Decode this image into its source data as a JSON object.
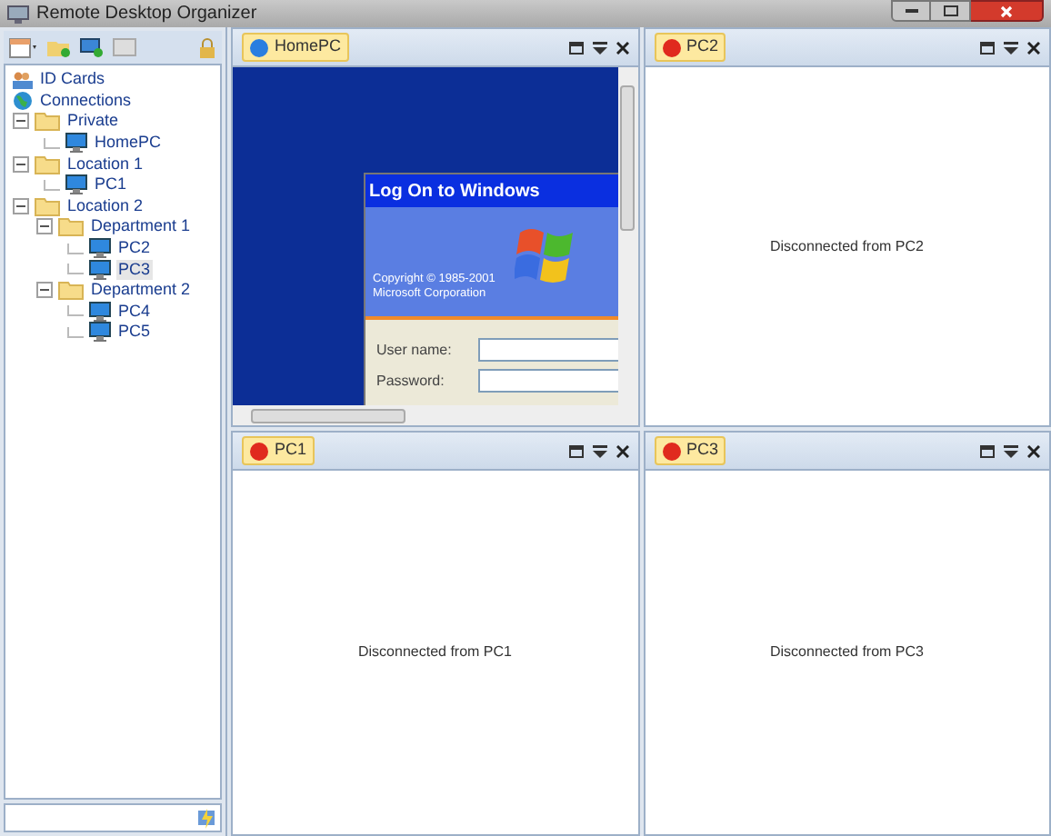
{
  "window": {
    "title": "Remote Desktop Organizer"
  },
  "tree": [
    {
      "label": "ID Cards",
      "kind": "cards",
      "selected": false
    },
    {
      "label": "Connections",
      "kind": "globe",
      "selected": false,
      "children": [
        {
          "label": "Private",
          "kind": "folder",
          "selected": false,
          "expanded": true,
          "children": [
            {
              "label": "HomePC",
              "kind": "pc",
              "selected": false
            }
          ]
        },
        {
          "label": "Location 1",
          "kind": "folder",
          "selected": false,
          "expanded": true,
          "children": [
            {
              "label": "PC1",
              "kind": "pc",
              "selected": false
            }
          ]
        },
        {
          "label": "Location 2",
          "kind": "folder",
          "selected": false,
          "expanded": true,
          "children": [
            {
              "label": "Department 1",
              "kind": "folder",
              "selected": false,
              "expanded": true,
              "children": [
                {
                  "label": "PC2",
                  "kind": "pc",
                  "selected": false
                },
                {
                  "label": "PC3",
                  "kind": "pc",
                  "selected": true
                }
              ]
            },
            {
              "label": "Department 2",
              "kind": "folder",
              "selected": false,
              "expanded": true,
              "children": [
                {
                  "label": "PC4",
                  "kind": "pc",
                  "selected": false
                },
                {
                  "label": "PC5",
                  "kind": "pc",
                  "selected": false
                }
              ]
            }
          ]
        }
      ]
    }
  ],
  "panes": [
    {
      "title": "HomePC",
      "connected": true,
      "remote_screen": {
        "dialog_title": "Log On to Windows",
        "copyright": "Copyright © 1985-2001",
        "company": "Microsoft Corporation",
        "fields": [
          {
            "label": "User name:"
          },
          {
            "label": "Password:"
          }
        ]
      }
    },
    {
      "title": "PC2",
      "connected": false,
      "message": "Disconnected from PC2"
    },
    {
      "title": "PC1",
      "connected": false,
      "message": "Disconnected from PC1"
    },
    {
      "title": "PC3",
      "connected": false,
      "message": "Disconnected from PC3"
    }
  ]
}
